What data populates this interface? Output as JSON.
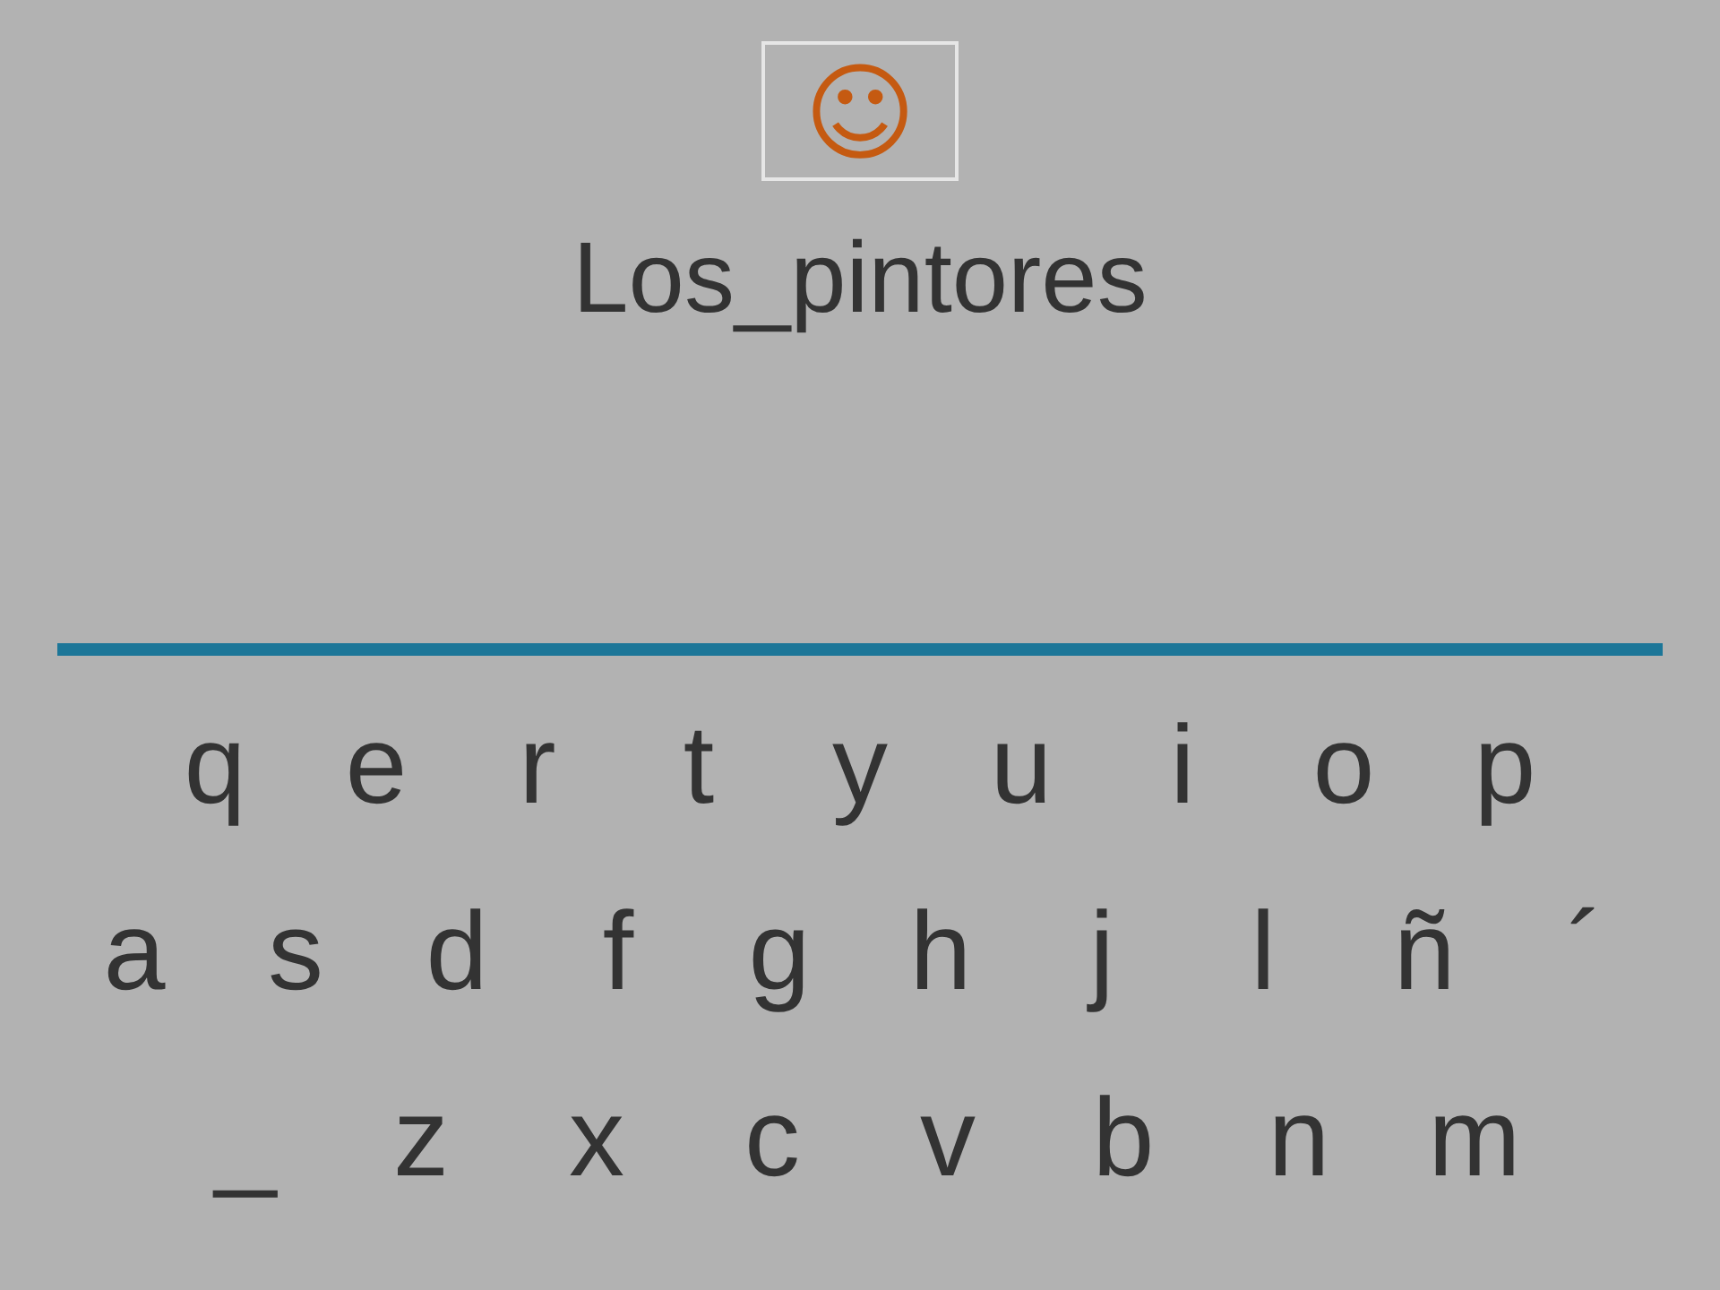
{
  "feedback": {
    "symbol": "☺"
  },
  "word": "Los_pintores",
  "keyboard": [
    [
      "q",
      "e",
      "r",
      "t",
      "y",
      "u",
      "i",
      "o",
      "p"
    ],
    [
      "a",
      "s",
      "d",
      "f",
      "g",
      "h",
      "j",
      "l",
      "ñ",
      "´"
    ],
    [
      "_",
      "z",
      "x",
      "c",
      "v",
      "b",
      "n",
      "m"
    ]
  ]
}
